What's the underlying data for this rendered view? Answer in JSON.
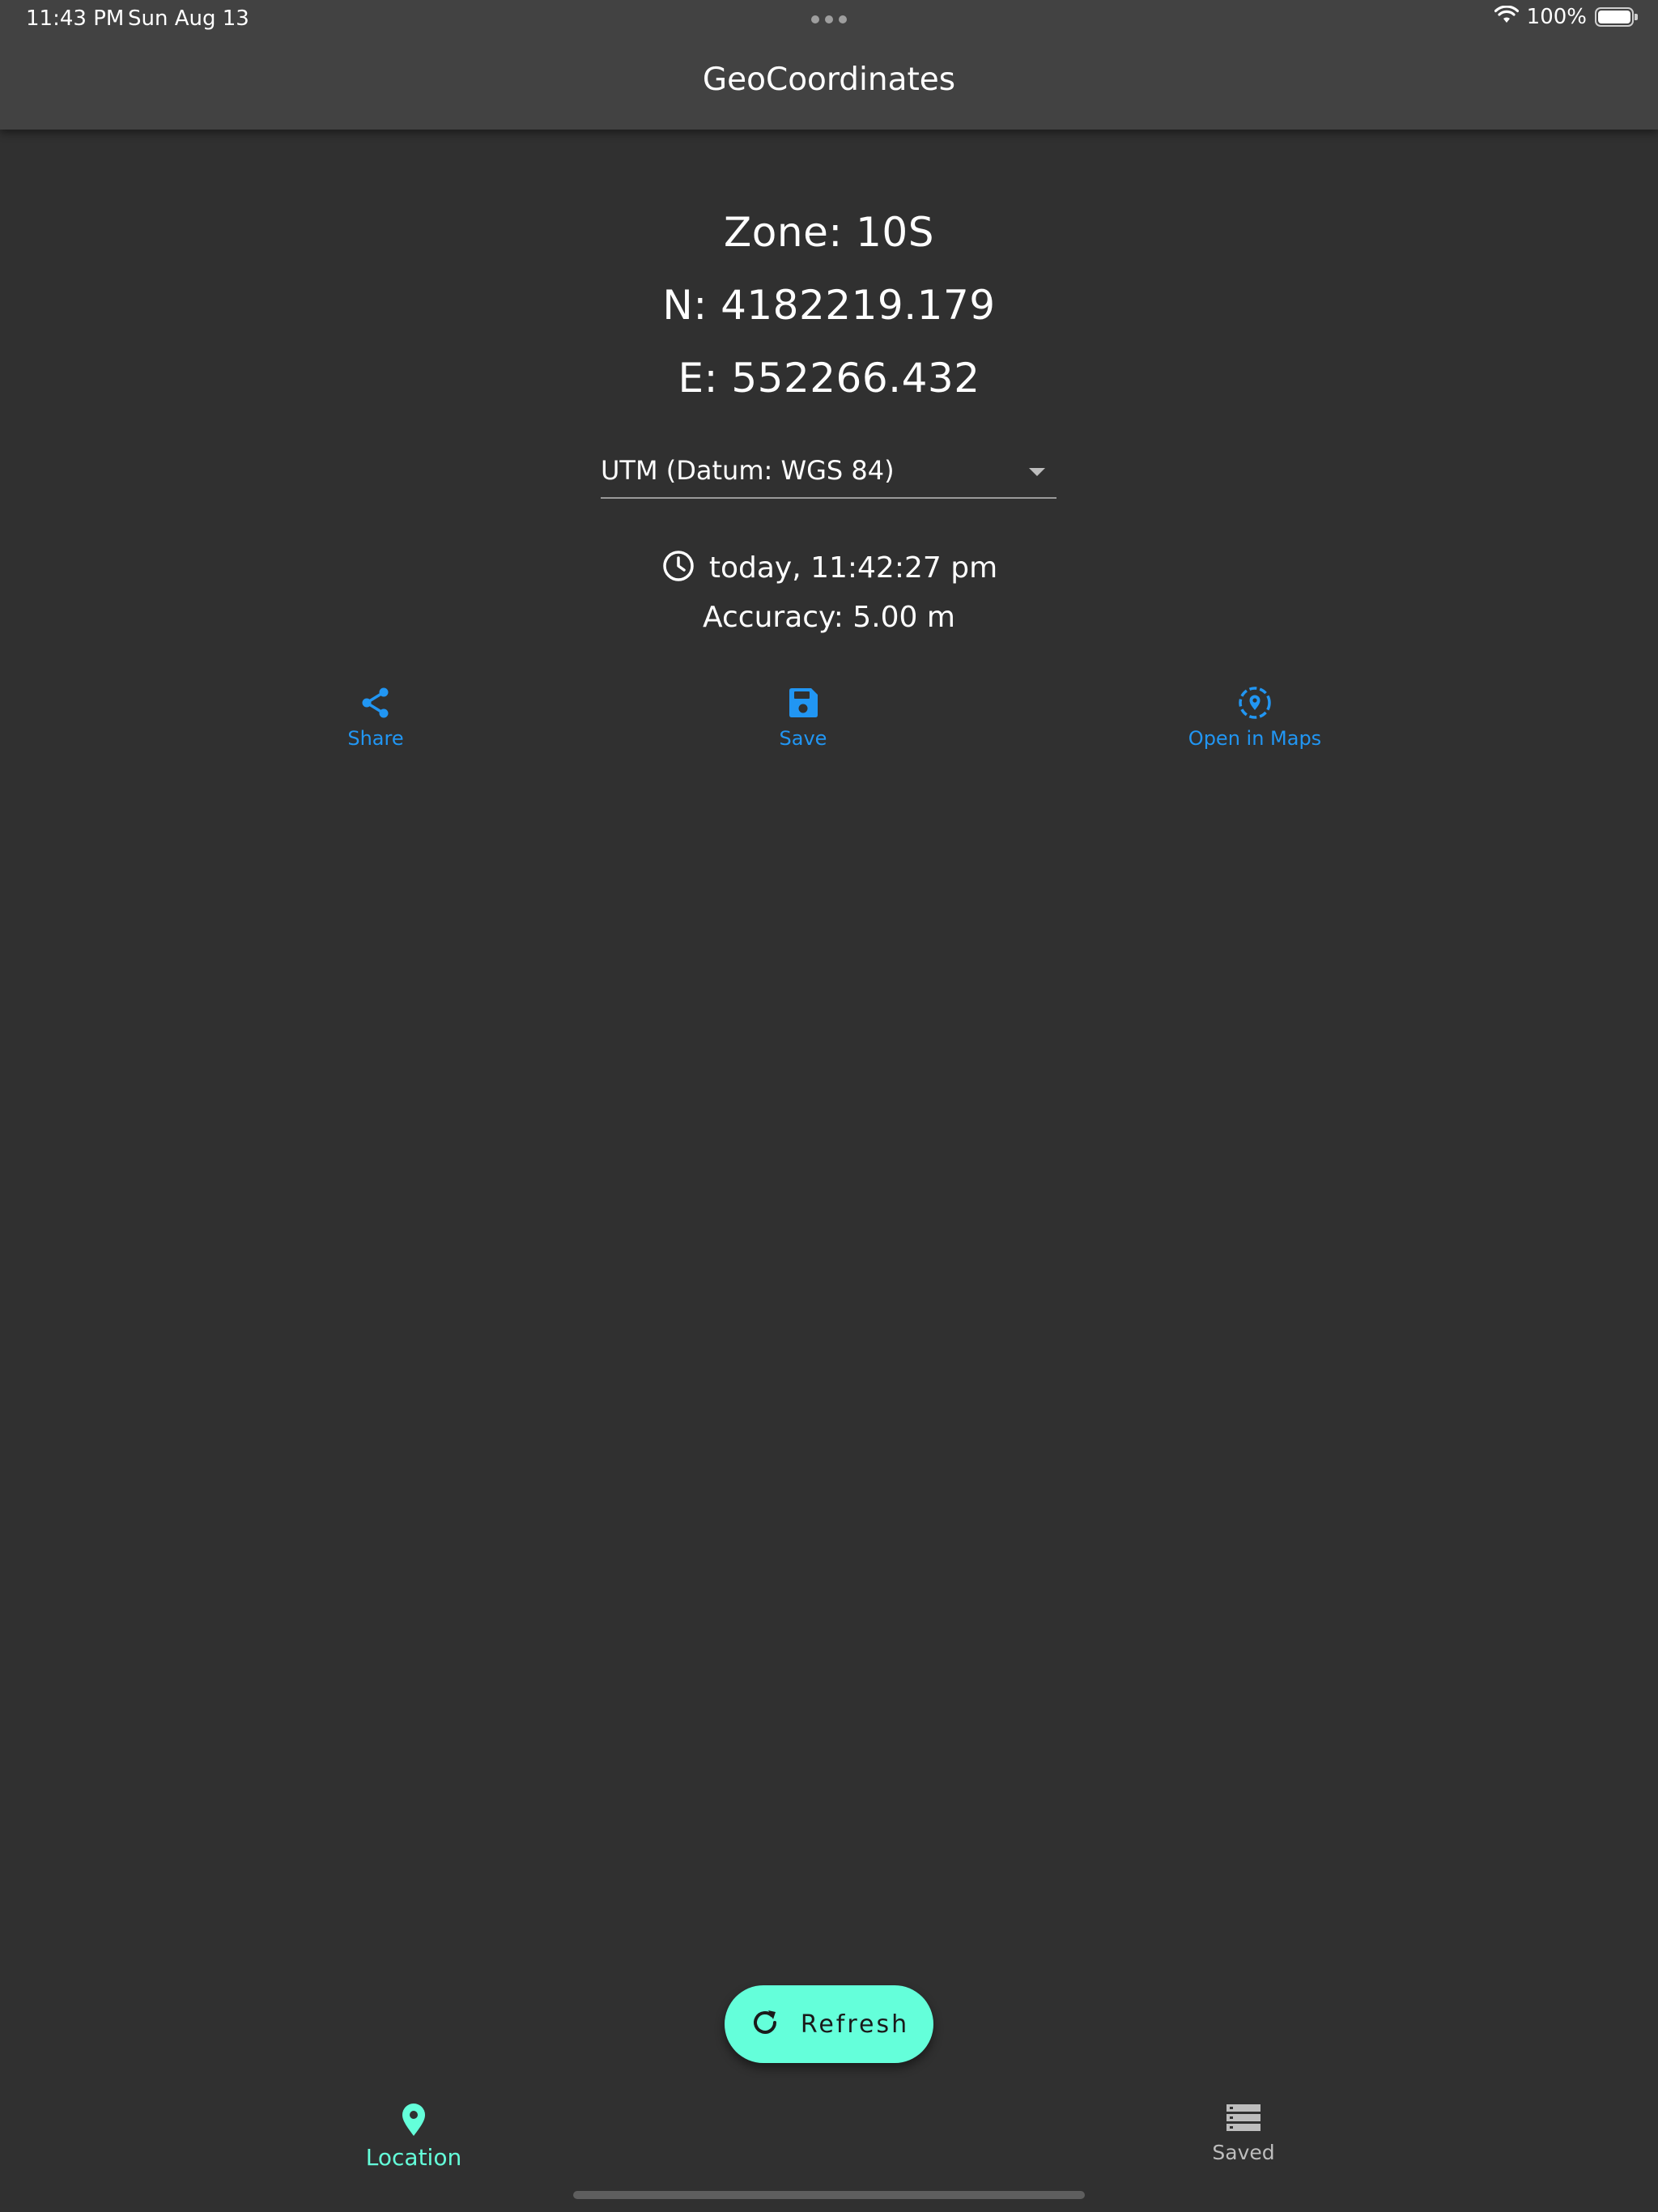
{
  "status_bar": {
    "time": "11:43 PM",
    "date": "Sun Aug 13",
    "battery": "100%",
    "icons": [
      "wifi-icon",
      "battery-icon"
    ]
  },
  "app_bar": {
    "title": "GeoCoordinates"
  },
  "coordinates": {
    "zone": "Zone: 10S",
    "northing": "N: 4182219.179",
    "easting": "E: 552266.432"
  },
  "format_select": {
    "selected": "UTM (Datum: WGS 84)"
  },
  "fix": {
    "timestamp": "today, 11:42:27 pm",
    "accuracy": "Accuracy: 5.00 m"
  },
  "actions": {
    "share": "Share",
    "save": "Save",
    "open_maps": "Open in Maps"
  },
  "fab": {
    "label": "Refresh"
  },
  "bottom_nav": {
    "location": "Location",
    "saved": "Saved"
  },
  "colors": {
    "background": "#303030",
    "app_bar": "#424242",
    "action_blue": "#2196f3",
    "accent_teal": "#64ffda",
    "inactive_gray": "#bdbdbd"
  }
}
